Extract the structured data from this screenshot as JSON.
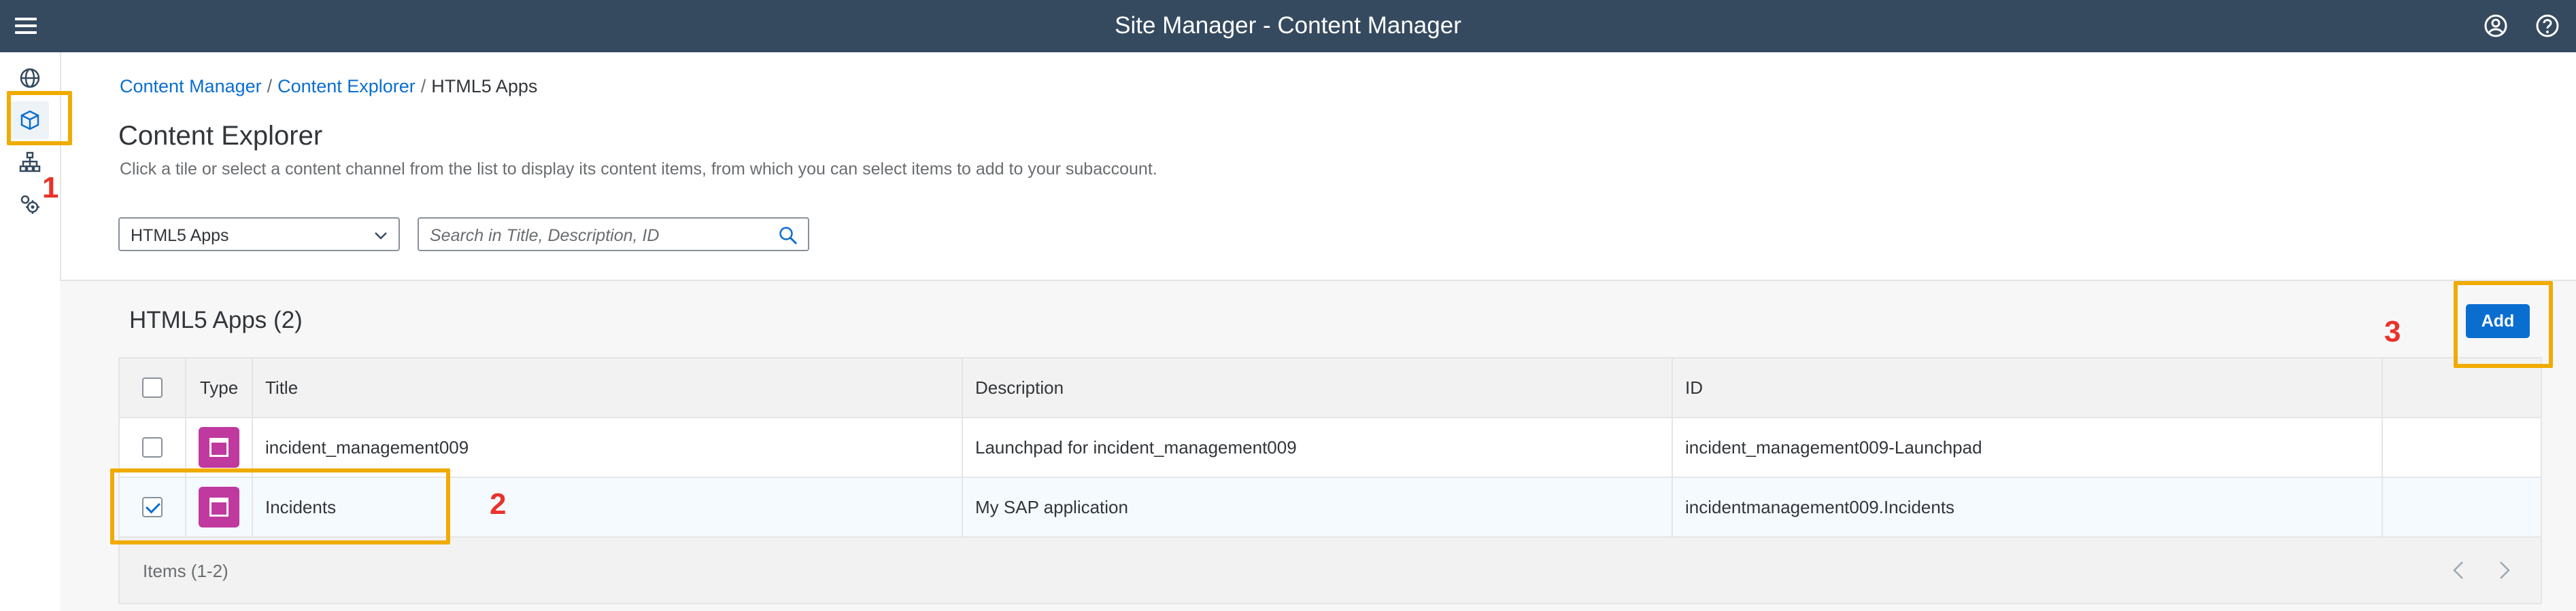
{
  "shell": {
    "title": "Site Manager - Content Manager",
    "menu_icon": "hamburger-icon",
    "profile_icon": "user-icon",
    "help_icon": "help-icon"
  },
  "leftnav": {
    "items": [
      {
        "icon": "globe-icon"
      },
      {
        "icon": "content-manager-icon"
      },
      {
        "icon": "hierarchy-icon"
      },
      {
        "icon": "settings-icon"
      }
    ]
  },
  "breadcrumb": {
    "items": [
      "Content Manager",
      "Content Explorer"
    ],
    "current": "HTML5 Apps",
    "separator": "/"
  },
  "page": {
    "title": "Content Explorer",
    "description": "Click a tile or select a content channel from the list to display its content items, from which you can select items to add to your subaccount."
  },
  "filter": {
    "channel_value": "HTML5 Apps",
    "search_placeholder": "Search in Title, Description, ID"
  },
  "section": {
    "title": "HTML5 Apps (2)",
    "add_label": "Add"
  },
  "table": {
    "columns": [
      "Type",
      "Title",
      "Description",
      "ID"
    ],
    "rows": [
      {
        "selected": false,
        "title": "incident_management009",
        "description": "Launchpad for incident_management009",
        "id": "incident_management009-Launchpad"
      },
      {
        "selected": true,
        "title": "Incidents",
        "description": "My SAP application",
        "id": "incidentmanagement009.Incidents"
      }
    ],
    "footer_count": "Items (1-2)"
  },
  "annotations": {
    "step1": "1",
    "step2": "2",
    "step3": "3"
  },
  "colors": {
    "shell": "#354a5f",
    "accent": "#0a6ed1",
    "tile": "#c0399f",
    "highlight": "#f0ab00",
    "step_number": "#e9322b"
  }
}
